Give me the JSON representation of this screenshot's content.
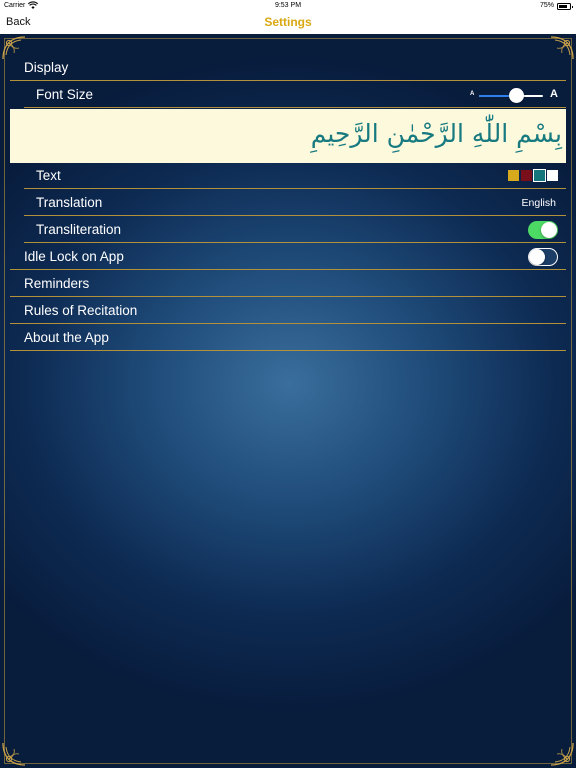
{
  "status_bar": {
    "carrier": "Carrier",
    "time": "9:53 PM",
    "battery": "75%"
  },
  "nav": {
    "back_label": "Back",
    "title": "Settings"
  },
  "settings": {
    "display": {
      "label": "Display"
    },
    "font_size": {
      "label": "Font Size",
      "small_glyph": "A",
      "large_glyph": "A",
      "level": 0.58
    },
    "preview_text": "بِسْمِ اللّٰهِ الرَّحْمٰنِ الرَّحِيمِ",
    "text_color": {
      "label": "Text",
      "options": [
        "#d6aa1c",
        "#7a0f1c",
        "#15777b",
        "#ffffff"
      ],
      "selected": "#15777b"
    },
    "translation": {
      "label": "Translation",
      "value": "English"
    },
    "transliteration": {
      "label": "Transliteration",
      "enabled": true
    },
    "idle_lock": {
      "label": "Idle Lock on App",
      "enabled": false
    },
    "reminders": {
      "label": "Reminders"
    },
    "rules": {
      "label": "Rules of Recitation"
    },
    "about": {
      "label": "About the App"
    }
  },
  "colors": {
    "accent_gold": "#d9a813",
    "divider_gold": "#b3903a",
    "toggle_on": "#4cd964",
    "preview_bg": "#fdf9dc",
    "preview_text": "#177a80"
  }
}
